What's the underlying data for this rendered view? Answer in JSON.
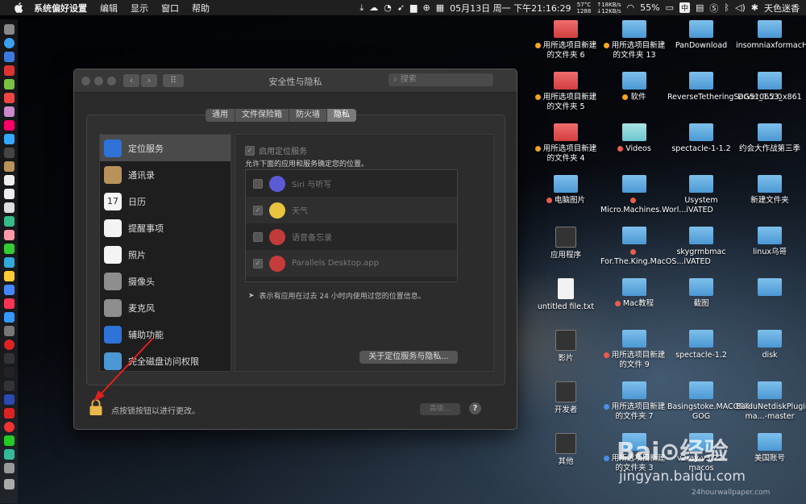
{
  "menubar": {
    "app_name": "系统偏好设置",
    "menus": [
      "编辑",
      "显示",
      "窗口",
      "帮助"
    ],
    "status": {
      "temp_top": "57°C",
      "temp_bottom": "1288",
      "net_up": "↑18KB/s",
      "net_down": "↓12KB/s",
      "datetime": "05月13日 周一 下午21:16:29",
      "battery": "55%",
      "input_method": "中",
      "user": "天色迷香"
    }
  },
  "window": {
    "title": "安全性与隐私",
    "search_placeholder": "搜索",
    "tabs": [
      {
        "label": "通用",
        "active": false
      },
      {
        "label": "文件保险箱",
        "active": false
      },
      {
        "label": "防火墙",
        "active": false
      },
      {
        "label": "隐私",
        "active": true
      }
    ],
    "sidebar": [
      {
        "label": "定位服务",
        "icon": "location-icon",
        "color": "#2f72d8",
        "active": true
      },
      {
        "label": "通讯录",
        "icon": "contacts-icon",
        "color": "#b8925a",
        "active": false
      },
      {
        "label": "日历",
        "icon": "calendar-icon",
        "color": "#f4f4f4",
        "text": "17",
        "active": false
      },
      {
        "label": "提醒事项",
        "icon": "reminders-icon",
        "color": "#f4f4f4",
        "active": false
      },
      {
        "label": "照片",
        "icon": "photos-icon",
        "color": "#f4f4f4",
        "active": false
      },
      {
        "label": "摄像头",
        "icon": "camera-icon",
        "color": "#8e8e8e",
        "active": false
      },
      {
        "label": "麦克风",
        "icon": "microphone-icon",
        "color": "#8e8e8e",
        "active": false
      },
      {
        "label": "辅助功能",
        "icon": "accessibility-icon",
        "color": "#2f72d8",
        "active": false
      },
      {
        "label": "完全磁盘访问权限",
        "icon": "folder-icon",
        "color": "#4b98d4",
        "active": false
      }
    ],
    "location": {
      "enable_label": "启用定位服务",
      "description": "允许下面的应用和服务确定您的位置。",
      "apps": [
        {
          "name": "Siri 与听写",
          "checked": false,
          "icon": "siri-icon",
          "color": "#5b5bd6"
        },
        {
          "name": "天气",
          "checked": true,
          "icon": "weather-icon",
          "color": "#e8c440"
        },
        {
          "name": "语音备忘录",
          "checked": false,
          "icon": "voice-memos-icon",
          "color": "#c23b3b"
        },
        {
          "name": "Parallels Desktop.app",
          "checked": true,
          "icon": "parallels-icon",
          "color": "#c63c3c"
        }
      ],
      "hint": "表示有应用在过去 24 小时内使用过您的位置信息。",
      "about_button": "关于定位服务与隐私..."
    },
    "lock_text": "点按锁按钮以进行更改。",
    "advanced_button": "高级...",
    "help_button": "?"
  },
  "desktop": [
    {
      "label": "用所选项目新建的文件夹 6",
      "type": "folder-red",
      "dot": "orange"
    },
    {
      "label": "用所选项目新建的文件夹 13",
      "type": "folder",
      "dot": "orange"
    },
    {
      "label": "PanDownload",
      "type": "folder",
      "dot": ""
    },
    {
      "label": "insomniaxformacHHB_jb51",
      "type": "folder",
      "dot": ""
    },
    {
      "label": "用所选项目新建的文件夹 5",
      "type": "folder-red",
      "dot": "orange"
    },
    {
      "label": "软件",
      "type": "folder",
      "dot": "orange"
    },
    {
      "label": "ReverseTetheringServer_1.2.0",
      "type": "folder",
      "dot": ""
    },
    {
      "label": "DG510653_x861",
      "type": "folder",
      "dot": ""
    },
    {
      "label": "用所选项目新建的文件夹 4",
      "type": "folder-red",
      "dot": "orange"
    },
    {
      "label": "Videos",
      "type": "folder-teal",
      "dot": "red"
    },
    {
      "label": "spectacle-1-1.2",
      "type": "folder",
      "dot": ""
    },
    {
      "label": "约会大作战第三季",
      "type": "folder",
      "dot": ""
    },
    {
      "label": "电脑图片",
      "type": "folder",
      "dot": "red"
    },
    {
      "label": "Micro.Machines.Worl...iVATED",
      "type": "folder",
      "dot": "red"
    },
    {
      "label": "Usystem",
      "type": "folder",
      "dot": ""
    },
    {
      "label": "新建文件夹",
      "type": "folder",
      "dot": ""
    },
    {
      "label": "应用程序",
      "type": "app",
      "dot": ""
    },
    {
      "label": "For.The.King.MacOS...iVATED",
      "type": "folder",
      "dot": "red"
    },
    {
      "label": "skygrmbmac",
      "type": "folder",
      "dot": ""
    },
    {
      "label": "linux乌哥",
      "type": "folder",
      "dot": ""
    },
    {
      "label": "untitled file.txt",
      "type": "file",
      "dot": ""
    },
    {
      "label": "Mac教程",
      "type": "folder",
      "dot": "red"
    },
    {
      "label": "截图",
      "type": "folder",
      "dot": ""
    },
    {
      "label": "",
      "type": "folder",
      "dot": ""
    },
    {
      "label": "影片",
      "type": "app",
      "dot": ""
    },
    {
      "label": "用所选项目新建的文件 9",
      "type": "folder",
      "dot": "red"
    },
    {
      "label": "spectacle-1.2",
      "type": "folder",
      "dot": ""
    },
    {
      "label": "disk",
      "type": "folder",
      "dot": ""
    },
    {
      "label": "开发者",
      "type": "app",
      "dot": ""
    },
    {
      "label": "用所选项目新建的文件夹 7",
      "type": "folder",
      "dot": "blue"
    },
    {
      "label": "Basingstoke.MACOSX-GOG",
      "type": "folder",
      "dot": ""
    },
    {
      "label": "BaiduNetdiskPlugin-ma...-master",
      "type": "folder",
      "dot": ""
    },
    {
      "label": "其他",
      "type": "app",
      "dot": ""
    },
    {
      "label": "用所选项目新建的文件夹 3",
      "type": "folder",
      "dot": "blue"
    },
    {
      "label": "v2ray-v3.22-macos",
      "type": "folder",
      "dot": ""
    },
    {
      "label": "美国账号",
      "type": "folder",
      "dot": ""
    }
  ],
  "watermark": {
    "brand": "Bai⊙经验",
    "url": "jingyan.baidu.com",
    "credit": "24hourwallpaper.com"
  }
}
